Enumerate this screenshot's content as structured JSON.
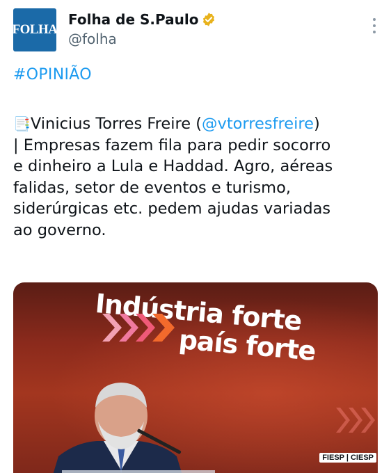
{
  "account": {
    "display_name": "Folha de S.Paulo",
    "handle": "@folha",
    "avatar_text": "FOLHA",
    "verified_color": "#e8b21c"
  },
  "tweet": {
    "hashtag": "#OPINIÃO",
    "memo_icon": "📑",
    "author": "Vinicius Torres Freire (",
    "mention": "@vtorresfreire",
    "author_close": ")",
    "body": "| Empresas fazem fila para pedir socorro\ne dinheiro a Lula e Haddad. Agro, aéreas\nfalidas, setor de eventos e turismo,\nsiderúrgicas etc. pedem ajudas variadas\nao governo."
  },
  "media": {
    "banner_line1": "Indústria forte",
    "banner_line2": "país forte",
    "logo_tag": "FIESP | CIESP"
  },
  "colors": {
    "link": "#1d9bf0",
    "avatar_bg": "#1b6aa8",
    "secondary_text": "#536471"
  }
}
